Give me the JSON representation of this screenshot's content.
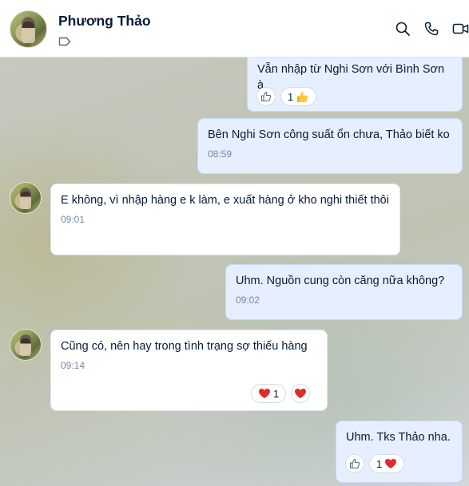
{
  "header": {
    "name": "Phương Thảo"
  },
  "colors": {
    "accent": "#0068ff",
    "bubble_me": "#e5efff",
    "bubble_them": "#ffffff",
    "heart": "#e02b2b",
    "time": "#7589a3"
  },
  "messages": [
    {
      "sender": "me",
      "text": "Vẫn nhập từ Nghi Sơn với Bình Sơn à",
      "reactions": {
        "count": "1",
        "emoji": "thumbs-up"
      }
    },
    {
      "sender": "me",
      "text": "Bên Nghi Sơn công suất ổn chưa, Thảo biết ko",
      "time": "08:59"
    },
    {
      "sender": "them",
      "text": "E không, vì nhập hàng e k làm, e xuất hàng ở kho nghi thiết thôi",
      "time": "09:01"
    },
    {
      "sender": "me",
      "text": "Uhm. Nguồn cung còn căng nữa không?",
      "time": "09:02"
    },
    {
      "sender": "them",
      "text": "Cũng có, nên hay trong tình trạng sợ thiếu hàng",
      "time": "09:14",
      "reactions": {
        "count": "1",
        "emoji": "heart"
      }
    },
    {
      "sender": "me",
      "text": "Uhm. Tks Thảo nha.",
      "reactions": {
        "count": "1",
        "emoji": "heart"
      }
    }
  ]
}
